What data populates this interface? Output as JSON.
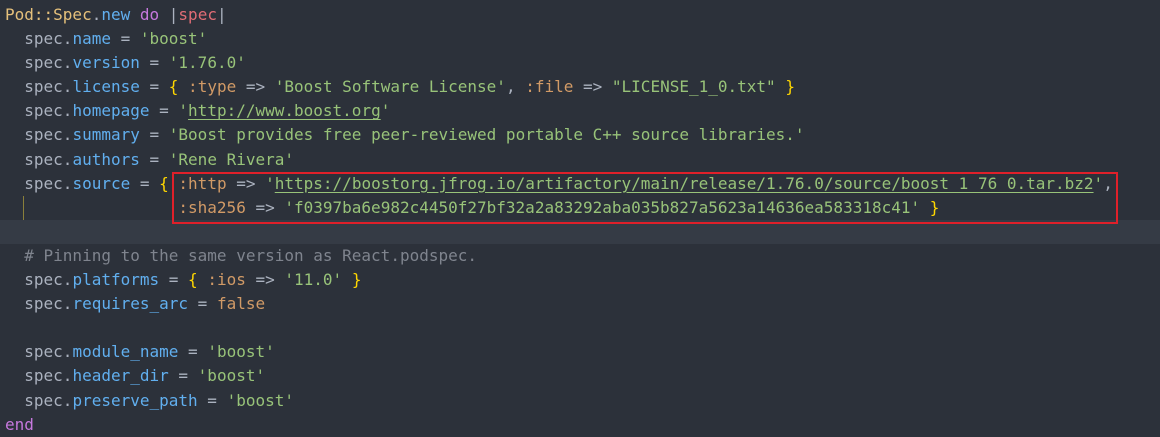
{
  "editor": {
    "current_line": 9,
    "lines": [
      [
        [
          "Pod::Spec",
          "const"
        ],
        [
          ".",
          "plain"
        ],
        [
          "new",
          "method"
        ],
        [
          " ",
          "plain"
        ],
        [
          "do",
          "kw"
        ],
        [
          " |",
          "plain"
        ],
        [
          "spec",
          "param"
        ],
        [
          "|",
          "plain"
        ]
      ],
      [
        [
          "  spec.",
          "plain"
        ],
        [
          "name",
          "method"
        ],
        [
          " = ",
          "plain"
        ],
        [
          "'boost'",
          "str"
        ]
      ],
      [
        [
          "  spec.",
          "plain"
        ],
        [
          "version",
          "method"
        ],
        [
          " = ",
          "plain"
        ],
        [
          "'1.76.0'",
          "str"
        ]
      ],
      [
        [
          "  spec.",
          "plain"
        ],
        [
          "license",
          "method"
        ],
        [
          " = ",
          "plain"
        ],
        [
          "{",
          "brace"
        ],
        [
          " :type",
          "sym"
        ],
        [
          " => ",
          "plain"
        ],
        [
          "'Boost Software License'",
          "str"
        ],
        [
          ", ",
          "plain"
        ],
        [
          ":file",
          "sym"
        ],
        [
          " => ",
          "plain"
        ],
        [
          "\"LICENSE_1_0.txt\"",
          "str"
        ],
        [
          " ",
          "plain"
        ],
        [
          "}",
          "brace"
        ]
      ],
      [
        [
          "  spec.",
          "plain"
        ],
        [
          "homepage",
          "method"
        ],
        [
          " = ",
          "plain"
        ],
        [
          "'",
          "str"
        ],
        [
          "http://www.boost.org",
          "link"
        ],
        [
          "'",
          "str"
        ]
      ],
      [
        [
          "  spec.",
          "plain"
        ],
        [
          "summary",
          "method"
        ],
        [
          " = ",
          "plain"
        ],
        [
          "'Boost provides free peer-reviewed portable C++ source libraries.'",
          "str"
        ]
      ],
      [
        [
          "  spec.",
          "plain"
        ],
        [
          "authors",
          "method"
        ],
        [
          " = ",
          "plain"
        ],
        [
          "'Rene Rivera'",
          "str"
        ]
      ],
      [
        [
          "  spec.",
          "plain"
        ],
        [
          "source",
          "method"
        ],
        [
          " = ",
          "plain"
        ],
        [
          "{",
          "brace"
        ],
        [
          " :http",
          "sym"
        ],
        [
          " => ",
          "plain"
        ],
        [
          "'",
          "str"
        ],
        [
          "https://boostorg.jfrog.io/artifactory/main/release/1.76.0/source/boost_1_76_0.tar.bz2",
          "link"
        ],
        [
          "'",
          "str"
        ],
        [
          ",",
          "plain"
        ]
      ],
      [
        [
          "                  ",
          "plain"
        ],
        [
          ":sha256",
          "sym"
        ],
        [
          " => ",
          "plain"
        ],
        [
          "'f0397ba6e982c4450f27bf32a2a83292aba035b827a5623a14636ea583318c41'",
          "str"
        ],
        [
          " ",
          "plain"
        ],
        [
          "}",
          "brace"
        ]
      ],
      [],
      [
        [
          "  # Pinning to the same version as React.podspec.",
          "comment"
        ]
      ],
      [
        [
          "  spec.",
          "plain"
        ],
        [
          "platforms",
          "method"
        ],
        [
          " = ",
          "plain"
        ],
        [
          "{",
          "brace"
        ],
        [
          " :ios",
          "sym"
        ],
        [
          " => ",
          "plain"
        ],
        [
          "'11.0'",
          "str"
        ],
        [
          " ",
          "plain"
        ],
        [
          "}",
          "brace"
        ]
      ],
      [
        [
          "  spec.",
          "plain"
        ],
        [
          "requires_arc",
          "method"
        ],
        [
          " = ",
          "plain"
        ],
        [
          "false",
          "bool"
        ]
      ],
      [],
      [
        [
          "  spec.",
          "plain"
        ],
        [
          "module_name",
          "method"
        ],
        [
          " = ",
          "plain"
        ],
        [
          "'boost'",
          "str"
        ]
      ],
      [
        [
          "  spec.",
          "plain"
        ],
        [
          "header_dir",
          "method"
        ],
        [
          " = ",
          "plain"
        ],
        [
          "'boost'",
          "str"
        ]
      ],
      [
        [
          "  spec.",
          "plain"
        ],
        [
          "preserve_path",
          "method"
        ],
        [
          " = ",
          "plain"
        ],
        [
          "'boost'",
          "str"
        ]
      ],
      [
        [
          "end",
          "kw"
        ]
      ]
    ]
  }
}
